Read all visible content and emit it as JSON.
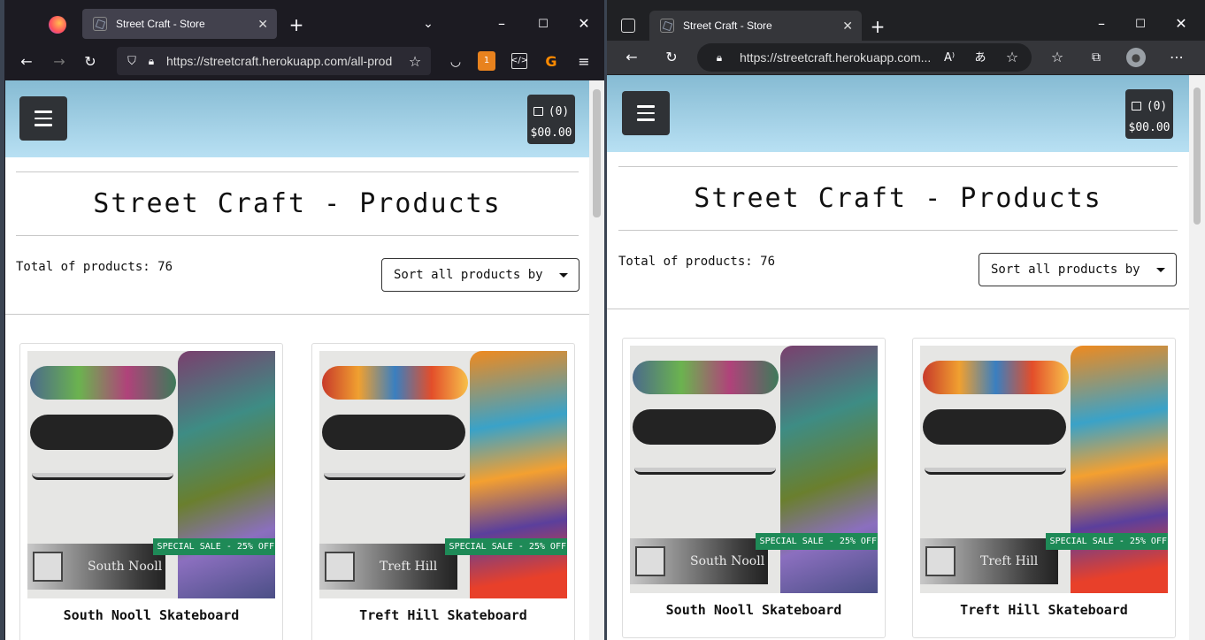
{
  "browsers": {
    "tab_title": "Street Craft - Store",
    "firefox_url": "https://streetcraft.herokuapp.com/all-prod",
    "edge_url": "https://streetcraft.herokuapp.com..."
  },
  "page": {
    "cart_count": "(0)",
    "cart_total": "$00.00",
    "title": "Street Craft - Products",
    "total": "Total of products: 76",
    "sort_label": "Sort all products by"
  },
  "products": [
    {
      "name": "South Nooll Skateboard",
      "logo_text": "South Nooll",
      "badge": "SPECIAL SALE - 25% OFF"
    },
    {
      "name": "Treft Hill Skateboard",
      "logo_text": "Treft Hill",
      "badge": "SPECIAL SALE - 25% OFF"
    }
  ],
  "colors": {
    "header": "#8fc4dc",
    "dark": "#2f3236",
    "sale": "#1e8a57"
  }
}
